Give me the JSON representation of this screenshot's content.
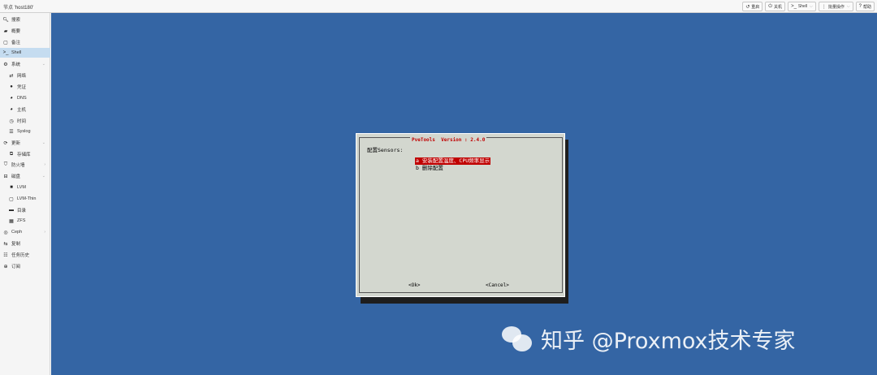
{
  "header": {
    "node_title": "节点 'host180'",
    "toolbar": [
      {
        "icon": "↺",
        "icon_name": "reboot-icon",
        "label": "重启",
        "dropdown": false
      },
      {
        "icon": "⏻",
        "icon_name": "power-icon",
        "label": "关机",
        "dropdown": false
      },
      {
        "icon": ">_",
        "icon_name": "terminal-icon",
        "label": "Shell",
        "dropdown": true
      },
      {
        "icon": "⋮",
        "icon_name": "more-icon",
        "label": "批量操作",
        "dropdown": true
      },
      {
        "icon": "?",
        "icon_name": "help-icon",
        "label": "帮助",
        "dropdown": false
      }
    ]
  },
  "sidebar": {
    "items": [
      {
        "label": "搜索",
        "icon": "search-icon",
        "level": 0
      },
      {
        "label": "概要",
        "icon": "book-icon",
        "level": 0
      },
      {
        "label": "备注",
        "icon": "note-icon",
        "level": 0
      },
      {
        "label": "Shell",
        "icon": "terminal-icon",
        "level": 0,
        "active": true
      },
      {
        "label": "系统",
        "icon": "gears-icon",
        "level": 0,
        "expandable": true
      },
      {
        "label": "网络",
        "icon": "exchange-icon",
        "level": 1
      },
      {
        "label": "凭证",
        "icon": "certificate-icon",
        "level": 1
      },
      {
        "label": "DNS",
        "icon": "globe-icon",
        "level": 1
      },
      {
        "label": "主机",
        "icon": "globe-icon",
        "level": 1
      },
      {
        "label": "时间",
        "icon": "clock-icon",
        "level": 1
      },
      {
        "label": "Syslog",
        "icon": "list-icon",
        "level": 1
      },
      {
        "label": "更新",
        "icon": "refresh-icon",
        "level": 0,
        "expandable": true
      },
      {
        "label": "存储库",
        "icon": "files-icon",
        "level": 1
      },
      {
        "label": "防火墙",
        "icon": "shield-icon",
        "level": 0,
        "expandable": true
      },
      {
        "label": "磁盘",
        "icon": "hdd-icon",
        "level": 0,
        "expandable": true
      },
      {
        "label": "LVM",
        "icon": "square-icon",
        "level": 1
      },
      {
        "label": "LVM-Thin",
        "icon": "square-outline-icon",
        "level": 1
      },
      {
        "label": "目录",
        "icon": "folder-icon",
        "level": 1
      },
      {
        "label": "ZFS",
        "icon": "grid-icon",
        "level": 1
      },
      {
        "label": "Ceph",
        "icon": "ceph-icon",
        "level": 0,
        "expandable": true
      },
      {
        "label": "复制",
        "icon": "retweet-icon",
        "level": 0
      },
      {
        "label": "任务历史",
        "icon": "list-alt-icon",
        "level": 0
      },
      {
        "label": "订阅",
        "icon": "support-icon",
        "level": 0
      }
    ]
  },
  "dialog": {
    "title": "PveTools  Version : 2.4.0",
    "prompt": "配置Sensors:",
    "options": [
      {
        "key": "a",
        "label": "安装配置温度、CPU频率显示",
        "selected": true
      },
      {
        "key": "b",
        "label": "删除配置",
        "selected": false
      }
    ],
    "ok_label": "<Ok>",
    "cancel_label": "<Cancel>"
  },
  "watermark": {
    "text": "知乎 @Proxmox技术专家"
  },
  "colors": {
    "console_bg": "#3465a4",
    "dialog_bg": "#d3d7cf",
    "accent_red": "#c00000",
    "active_nav": "#c5dcf0"
  }
}
